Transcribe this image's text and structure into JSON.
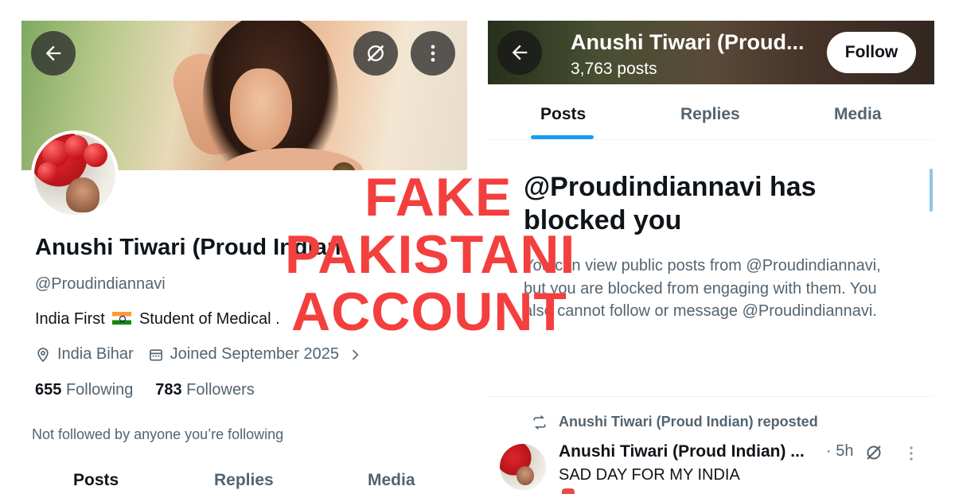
{
  "left_profile": {
    "name": "Anushi Tiwari (Proud Indian",
    "handle": "@Proudindiannavi",
    "bio_before_flag": "India First",
    "bio_after_flag": "Student of Medical .",
    "location": "India Bihar",
    "joined": "Joined September 2025",
    "following_count": "655",
    "following_label": "Following",
    "followers_count": "783",
    "followers_label": "Followers",
    "not_followed": "Not followed by anyone you’re following",
    "tabs": [
      "Posts",
      "Replies",
      "Media"
    ]
  },
  "right_profile": {
    "header_name": "Anushi Tiwari (Proud...",
    "post_count": "3,763 posts",
    "follow_button": "Follow",
    "tabs": [
      "Posts",
      "Replies",
      "Media"
    ],
    "blocked_title": "@Proudindiannavi has blocked you",
    "blocked_body": "You can view public posts from @Proudindiannavi, but you are blocked from engaging with them. You also cannot follow or message @Proudindiannavi.",
    "repost_label": "Anushi Tiwari (Proud Indian) reposted",
    "tweet": {
      "author": "Anushi Tiwari (Proud Indian) ...",
      "time": "· 5h",
      "text": "SAD DAY FOR MY INDIA"
    }
  },
  "overlay": {
    "line1": "FAKE",
    "line2": "PAKISTANI",
    "line3": "ACCOUNT"
  },
  "icons": {
    "back": "back-arrow-icon",
    "grok": "grok-icon",
    "more": "more-vertical-icon",
    "location": "location-pin-icon",
    "calendar": "calendar-icon",
    "chevron": "chevron-right-icon",
    "repost": "repost-icon"
  },
  "colors": {
    "overlay_red": "#f43f3f",
    "accent_blue": "#1d9bf0",
    "secondary_text": "#536471",
    "primary_text": "#0f1419"
  }
}
